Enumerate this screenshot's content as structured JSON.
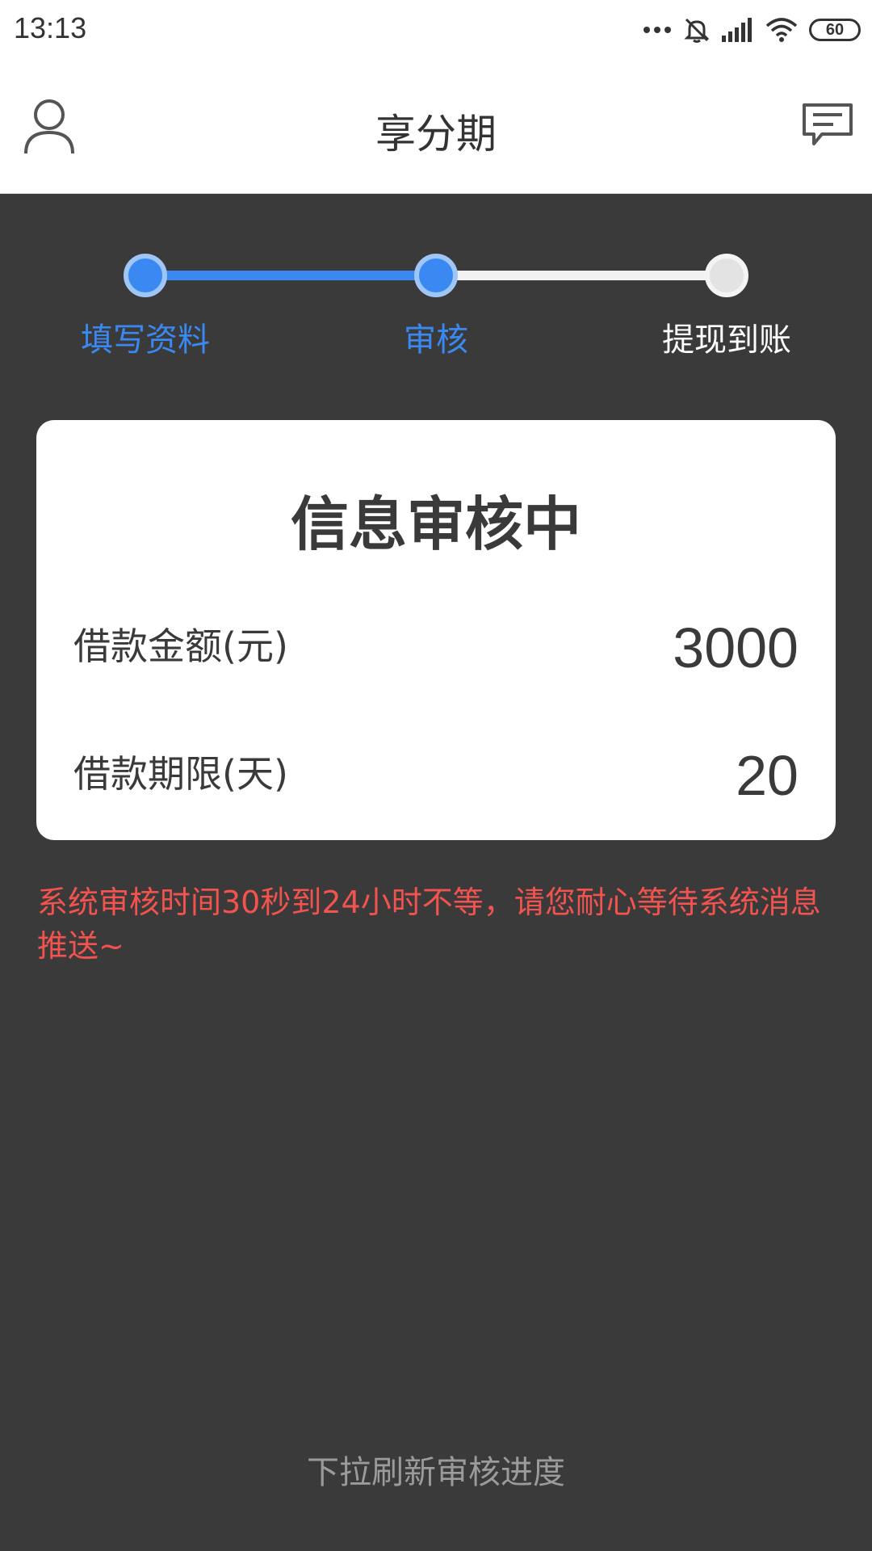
{
  "status_bar": {
    "time": "13:13",
    "battery": "60",
    "icons": [
      "more-dots-icon",
      "mute-bell-icon",
      "signal-icon",
      "wifi-icon",
      "battery-icon"
    ]
  },
  "header": {
    "title": "享分期",
    "left_icon": "user-icon",
    "right_icon": "message-icon"
  },
  "steps": [
    {
      "label": "填写资料",
      "state": "done"
    },
    {
      "label": "审核",
      "state": "current"
    },
    {
      "label": "提现到账",
      "state": "pending"
    }
  ],
  "card": {
    "title": "信息审核中",
    "amount_label": "借款金额(元)",
    "amount_value": "3000",
    "term_label": "借款期限(天)",
    "term_value": "20"
  },
  "notice": "系统审核时间30秒到24小时不等，请您耐心等待系统消息推送~",
  "pull_hint": "下拉刷新审核进度",
  "colors": {
    "accent": "#3a89f2",
    "background": "#3a3a3a",
    "notice": "#f2534f"
  }
}
